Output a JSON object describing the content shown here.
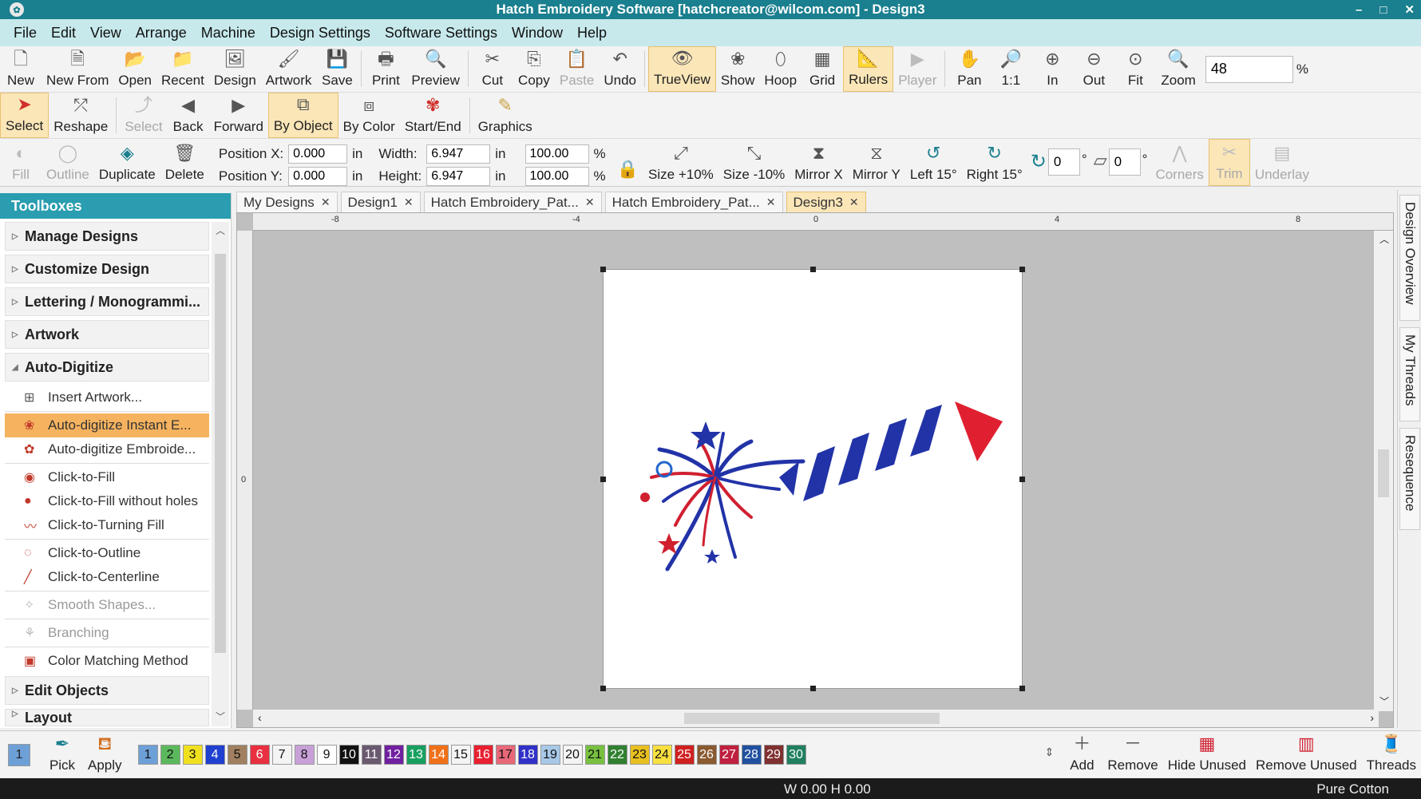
{
  "titlebar": {
    "title": "Hatch Embroidery Software [hatchcreator@wilcom.com] - Design3",
    "minimize": "–",
    "maximize": "□",
    "close": "✕"
  },
  "menu": [
    "File",
    "Edit",
    "View",
    "Arrange",
    "Machine",
    "Design Settings",
    "Software Settings",
    "Window",
    "Help"
  ],
  "toolbar1": {
    "new": "New",
    "new_from": "New From",
    "open": "Open",
    "recent": "Recent",
    "design": "Design",
    "artwork": "Artwork",
    "save": "Save",
    "print": "Print",
    "preview": "Preview",
    "cut": "Cut",
    "copy": "Copy",
    "paste": "Paste",
    "undo": "Undo",
    "trueview": "TrueView",
    "show": "Show",
    "hoop": "Hoop",
    "grid": "Grid",
    "rulers": "Rulers",
    "player": "Player",
    "pan": "Pan",
    "one_to_one": "1:1",
    "zoom_in": "In",
    "zoom_out": "Out",
    "fit": "Fit",
    "zoom": "Zoom",
    "zoom_value": "48",
    "zoom_unit": "%"
  },
  "toolbar2": {
    "select": "Select",
    "reshape": "Reshape",
    "select2": "Select",
    "back": "Back",
    "forward": "Forward",
    "by_object": "By Object",
    "by_color": "By Color",
    "start_end": "Start/End",
    "graphics": "Graphics"
  },
  "toolbar3": {
    "fill": "Fill",
    "outline": "Outline",
    "duplicate": "Duplicate",
    "delete": "Delete",
    "position_x_label": "Position X:",
    "position_x": "0.000",
    "position_y_label": "Position Y:",
    "position_y": "0.000",
    "unit": "in",
    "width_label": "Width:",
    "width": "6.947",
    "height_label": "Height:",
    "height": "6.947",
    "width_pct": "100.00",
    "height_pct": "100.00",
    "pct": "%",
    "size_plus": "Size +10%",
    "size_minus": "Size -10%",
    "mirror_x": "Mirror X",
    "mirror_y": "Mirror Y",
    "left15": "Left 15°",
    "right15": "Right 15°",
    "rotate_value": "0",
    "slant_value": "0",
    "deg": "°",
    "corners": "Corners",
    "trim": "Trim",
    "underlay": "Underlay"
  },
  "toolboxes": {
    "header": "Toolboxes",
    "sections": {
      "manage": "Manage Designs",
      "customize": "Customize Design",
      "lettering": "Lettering / Monogrammi...",
      "artwork": "Artwork",
      "auto_digitize": "Auto-Digitize",
      "edit_objects": "Edit Objects",
      "layout": "Layout"
    },
    "items": {
      "insert_artwork": "Insert Artwork...",
      "instant": "Auto-digitize Instant E...",
      "embroidery": "Auto-digitize Embroide...",
      "click_fill": "Click-to-Fill",
      "click_fill_no_holes": "Click-to-Fill without holes",
      "click_turning": "Click-to-Turning Fill",
      "click_outline": "Click-to-Outline",
      "click_centerline": "Click-to-Centerline",
      "smooth": "Smooth Shapes...",
      "branching": "Branching",
      "color_matching": "Color Matching Method"
    }
  },
  "tabs": [
    "My Designs",
    "Design1",
    "Hatch Embroidery_Pat...",
    "Hatch Embroidery_Pat...",
    "Design3"
  ],
  "ruler": {
    "top_labels": [
      "-8",
      "-4",
      "0",
      "4",
      "8"
    ],
    "left_label": "0"
  },
  "side_tabs": [
    "Design Overview",
    "My Threads",
    "Resequence"
  ],
  "colorbar": {
    "current": "1",
    "pick": "Pick",
    "apply": "Apply",
    "swatches": [
      {
        "n": "1",
        "c": "#6ea0d8",
        "t": "#111"
      },
      {
        "n": "2",
        "c": "#5cb85c",
        "t": "#111"
      },
      {
        "n": "3",
        "c": "#f0e020",
        "t": "#111"
      },
      {
        "n": "4",
        "c": "#2040d0",
        "t": "#fff"
      },
      {
        "n": "5",
        "c": "#a08060",
        "t": "#111"
      },
      {
        "n": "6",
        "c": "#e83040",
        "t": "#fff"
      },
      {
        "n": "7",
        "c": "#f4f4f4",
        "t": "#111"
      },
      {
        "n": "8",
        "c": "#c8a0d8",
        "t": "#111"
      },
      {
        "n": "9",
        "c": "#ffffff",
        "t": "#111"
      },
      {
        "n": "10",
        "c": "#111111",
        "t": "#fff"
      },
      {
        "n": "11",
        "c": "#6a5a70",
        "t": "#fff"
      },
      {
        "n": "12",
        "c": "#7020a0",
        "t": "#fff"
      },
      {
        "n": "13",
        "c": "#18a060",
        "t": "#fff"
      },
      {
        "n": "14",
        "c": "#f07018",
        "t": "#fff"
      },
      {
        "n": "15",
        "c": "#f4f4f4",
        "t": "#111"
      },
      {
        "n": "16",
        "c": "#e82030",
        "t": "#fff"
      },
      {
        "n": "17",
        "c": "#e86878",
        "t": "#111"
      },
      {
        "n": "18",
        "c": "#3030c8",
        "t": "#fff"
      },
      {
        "n": "19",
        "c": "#a8c8e8",
        "t": "#111"
      },
      {
        "n": "20",
        "c": "#f4f4f4",
        "t": "#111"
      },
      {
        "n": "21",
        "c": "#78c040",
        "t": "#111"
      },
      {
        "n": "22",
        "c": "#308030",
        "t": "#fff"
      },
      {
        "n": "23",
        "c": "#e8c020",
        "t": "#111"
      },
      {
        "n": "24",
        "c": "#f8e040",
        "t": "#111"
      },
      {
        "n": "25",
        "c": "#d02020",
        "t": "#fff"
      },
      {
        "n": "26",
        "c": "#8a5a30",
        "t": "#fff"
      },
      {
        "n": "27",
        "c": "#c02040",
        "t": "#fff"
      },
      {
        "n": "28",
        "c": "#2050a0",
        "t": "#fff"
      },
      {
        "n": "29",
        "c": "#803030",
        "t": "#fff"
      },
      {
        "n": "30",
        "c": "#208060",
        "t": "#fff"
      }
    ],
    "add": "Add",
    "remove": "Remove",
    "hide_unused": "Hide Unused",
    "remove_unused": "Remove Unused",
    "threads": "Threads"
  },
  "status": {
    "size": "W 0.00 H 0.00",
    "thread": "Pure Cotton"
  }
}
